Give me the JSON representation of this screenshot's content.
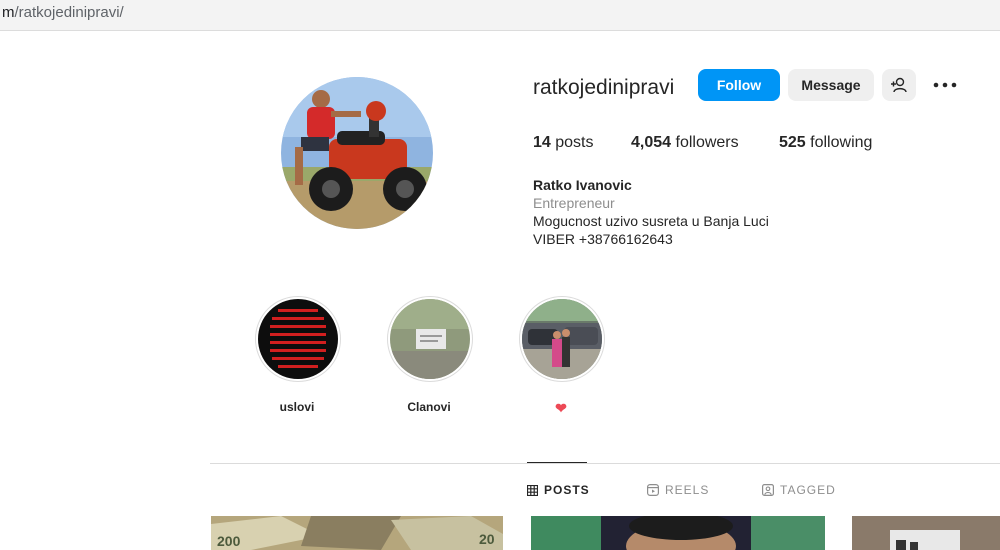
{
  "browser": {
    "url_prefix": "m",
    "url_path": "/ratkojedinipravi/"
  },
  "profile": {
    "username": "ratkojedinipravi",
    "follow_label": "Follow",
    "message_label": "Message",
    "stats": {
      "posts_count": "14",
      "posts_label": "posts",
      "followers_count": "4,054",
      "followers_label": "followers",
      "following_count": "525",
      "following_label": "following"
    },
    "bio": {
      "name": "Ratko Ivanovic",
      "category": "Entrepreneur",
      "line1": "Mogucnost uzivo susreta u Banja Luci",
      "line2": "VIBER +38766162643"
    }
  },
  "highlights": [
    {
      "label": "uslovi"
    },
    {
      "label": "Clanovi"
    },
    {
      "label": "❤"
    }
  ],
  "tabs": [
    {
      "label": "POSTS",
      "icon": "grid-icon",
      "active": true
    },
    {
      "label": "REELS",
      "icon": "reels-icon",
      "active": false
    },
    {
      "label": "TAGGED",
      "icon": "tagged-icon",
      "active": false
    }
  ],
  "colors": {
    "follow_button": "#0095f6",
    "secondary_button": "#efefef",
    "heart": "#ed4956"
  }
}
